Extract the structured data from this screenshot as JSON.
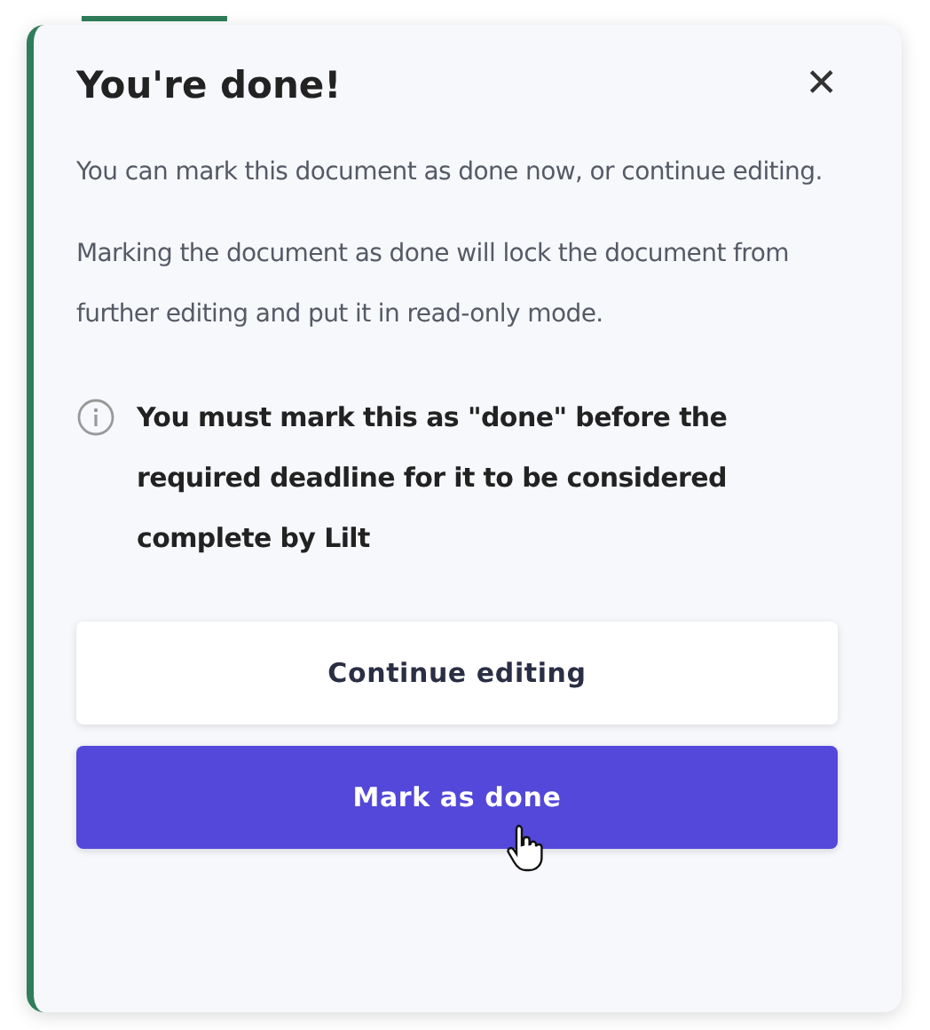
{
  "dialog": {
    "title": "You're done!",
    "close": "✕",
    "paragraphs": [
      "You can mark this document as done now, or continue editing.",
      "Marking the document as done will lock the document from further editing and put it in read-only mode."
    ],
    "notice": "You must mark this as \"done\" before the required deadline for it to be considered complete by Lilt",
    "buttons": [
      {
        "label": "Continue editing",
        "kind": "secondary"
      },
      {
        "label": "Mark as done",
        "kind": "primary"
      }
    ]
  }
}
